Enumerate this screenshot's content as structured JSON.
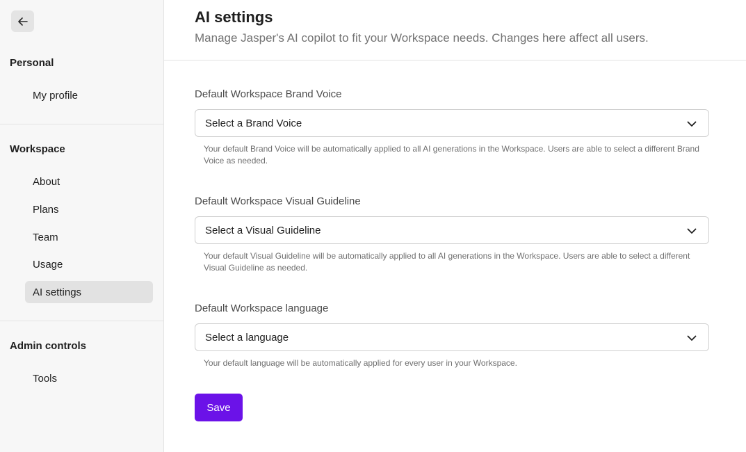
{
  "sidebar": {
    "sections": [
      {
        "title": "Personal",
        "items": [
          {
            "label": "My profile"
          }
        ]
      },
      {
        "title": "Workspace",
        "items": [
          {
            "label": "About"
          },
          {
            "label": "Plans"
          },
          {
            "label": "Team"
          },
          {
            "label": "Usage"
          },
          {
            "label": "AI settings",
            "active": true
          }
        ]
      },
      {
        "title": "Admin controls",
        "items": [
          {
            "label": "Tools"
          }
        ]
      }
    ]
  },
  "header": {
    "title": "AI settings",
    "subtitle": "Manage Jasper's AI copilot to fit your Workspace needs. Changes here affect all users."
  },
  "fields": [
    {
      "label": "Default Workspace Brand Voice",
      "value": "Select a Brand Voice",
      "help": "Your default Brand Voice will be automatically applied to all AI generations in the Workspace. Users are able to select a different Brand Voice as needed."
    },
    {
      "label": "Default Workspace Visual Guideline",
      "value": "Select a Visual Guideline",
      "help": "Your default Visual Guideline will be automatically applied to all AI generations in the Workspace. Users are able to select a different Visual Guideline as needed."
    },
    {
      "label": "Default Workspace language",
      "value": "Select a language",
      "help": "Your default language will be automatically applied for every user in your Workspace."
    }
  ],
  "actions": {
    "save_label": "Save"
  },
  "colors": {
    "accent": "#6b12e8",
    "active_nav": "#e2e2e2",
    "sidebar_bg": "#f7f7f7"
  }
}
